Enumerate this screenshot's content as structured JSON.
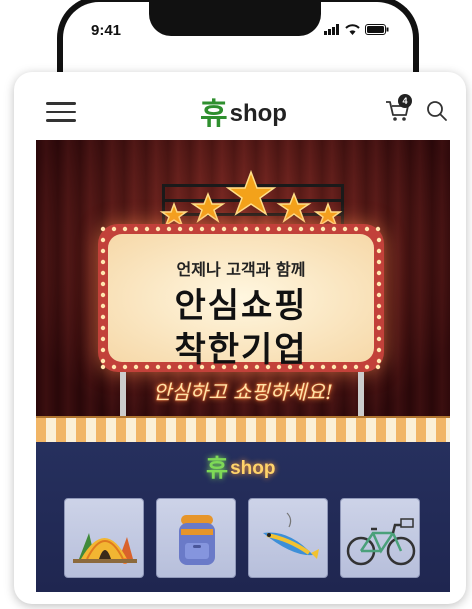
{
  "status_bar": {
    "time": "9:41",
    "icons": [
      "signal-icon",
      "wifi-icon",
      "battery-icon"
    ]
  },
  "header": {
    "menu_icon": "hamburger-menu-icon",
    "logo": {
      "mark": "휴",
      "text": "shop"
    },
    "cart": {
      "icon": "cart-icon",
      "count": "4"
    },
    "search_icon": "search-icon"
  },
  "banner": {
    "sign": {
      "subtitle": "언제나 고객과 함께",
      "line1": "안심쇼핑",
      "line2": "착한기업"
    },
    "tagline": "안심하고 쇼핑하세요!",
    "shop_logo": {
      "mark": "휴",
      "text": "shop"
    },
    "categories": [
      {
        "icon": "tent-camping-icon"
      },
      {
        "icon": "backpack-icon"
      },
      {
        "icon": "fishing-lure-icon"
      },
      {
        "icon": "bicycle-icon"
      }
    ]
  },
  "colors": {
    "logo_green": "#2f8f2f",
    "stage_red": "#5a1416",
    "shop_navy": "#26305e",
    "neon_gold": "#ffd36a"
  }
}
